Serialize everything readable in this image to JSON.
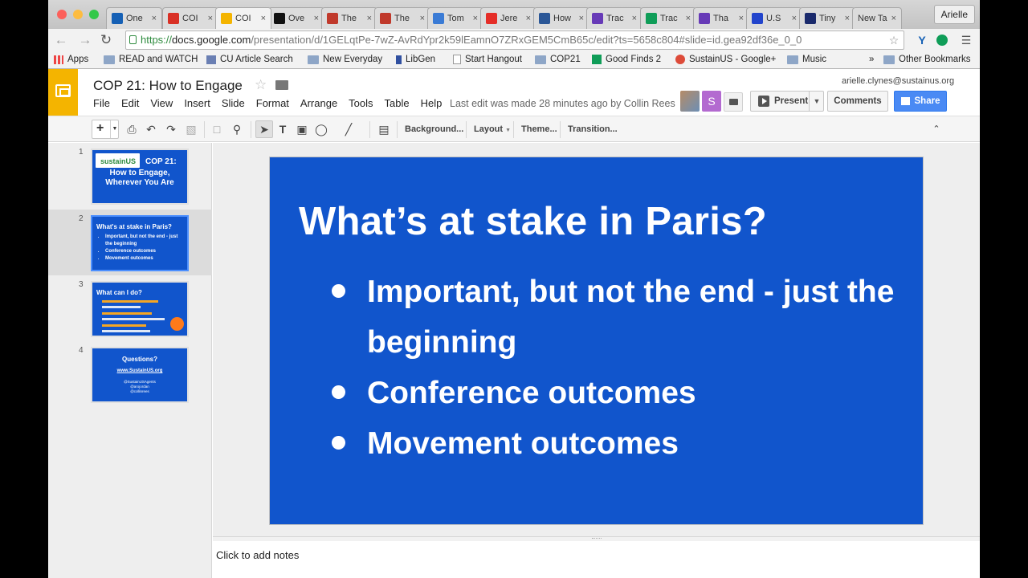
{
  "browser": {
    "tabs": [
      {
        "label": "One",
        "icon": "y-icon",
        "color": "#1560b5"
      },
      {
        "label": "COI",
        "icon": "gmail-icon",
        "color": "#d93025"
      },
      {
        "label": "COI",
        "icon": "slides-icon",
        "color": "#f4b400"
      },
      {
        "label": "Ove",
        "icon": "dash-icon",
        "color": "#111111"
      },
      {
        "label": "The",
        "icon": "n-icon",
        "color": "#c0392b"
      },
      {
        "label": "The",
        "icon": "br-icon",
        "color": "#c0392b"
      },
      {
        "label": "Tom",
        "icon": "td-icon",
        "color": "#3a7bd5"
      },
      {
        "label": "Jere",
        "icon": "youtube-icon",
        "color": "#e52d27"
      },
      {
        "label": "How",
        "icon": "hg-icon",
        "color": "#2b5797"
      },
      {
        "label": "Trac",
        "icon": "forms-icon",
        "color": "#673ab7"
      },
      {
        "label": "Trac",
        "icon": "sheets-icon",
        "color": "#0f9d58"
      },
      {
        "label": "Tha",
        "icon": "forms-icon",
        "color": "#673ab7"
      },
      {
        "label": "U.S",
        "icon": "b-icon",
        "color": "#2244cc"
      },
      {
        "label": "Tiny",
        "icon": "tinyurl-icon",
        "color": "#1a2a6c"
      },
      {
        "label": "New Ta",
        "icon": "",
        "color": ""
      }
    ],
    "user_label": "Arielle",
    "url": {
      "scheme": "https://",
      "host": "docs.google.com",
      "path": "/presentation/d/1GELqtPe-7wZ-AvRdYpr2k59lEamnO7ZRxGEM5CmB65c/edit?ts=5658c804#slide=id.gea92df36e_0_0"
    },
    "bookmarks": [
      {
        "label": "Apps",
        "icon": "apps-grid-icon"
      },
      {
        "label": "READ and WATCH",
        "icon": "folder-icon"
      },
      {
        "label": "CU Article Search",
        "icon": "crown-icon"
      },
      {
        "label": "New Everyday",
        "icon": "folder-icon"
      },
      {
        "label": "LibGen",
        "icon": "libgen-icon"
      },
      {
        "label": "Start Hangout",
        "icon": "page-icon"
      },
      {
        "label": "COP21",
        "icon": "folder-icon"
      },
      {
        "label": "Good Finds 2",
        "icon": "sheets-icon"
      },
      {
        "label": "SustainUS - Google+",
        "icon": "gplus-icon"
      },
      {
        "label": "Music",
        "icon": "folder-icon"
      }
    ],
    "bookmarks_overflow": "»",
    "other_bookmarks": "Other Bookmarks"
  },
  "app": {
    "title": "COP 21: How to Engage",
    "menu": [
      "File",
      "Edit",
      "View",
      "Insert",
      "Slide",
      "Format",
      "Arrange",
      "Tools",
      "Table",
      "Help"
    ],
    "last_edit": "Last edit was made 28 minutes ago by Collin Rees",
    "account_email": "arielle.clynes@sustainus.org",
    "collaborator_initial": "S",
    "present_label": "Present",
    "comments_label": "Comments",
    "share_label": "Share"
  },
  "toolbar": {
    "background_label": "Background...",
    "layout_label": "Layout",
    "theme_label": "Theme...",
    "transition_label": "Transition..."
  },
  "filmstrip": [
    {
      "number": "1",
      "logo_text": "sustainUS",
      "title_top": "COP 21:",
      "title_rest": "How to Engage, Wherever You Are"
    },
    {
      "number": "2",
      "title": "What's at stake in Paris?",
      "bullets": [
        "Important, but not the end - just the beginning",
        "Conference outcomes",
        "Movement outcomes"
      ]
    },
    {
      "number": "3",
      "title": "What can I do?"
    },
    {
      "number": "4",
      "title": "Questions?",
      "url": "www.SustainUS.org",
      "handles": [
        "@SustainUSAgents",
        "@arojordan",
        "@collinrees"
      ]
    }
  ],
  "slide": {
    "title": "What’s at stake in Paris?",
    "bullets": [
      "Important, but not the end - just the beginning",
      "Conference outcomes",
      "Movement outcomes"
    ],
    "background_color": "#1155cc"
  },
  "notes": {
    "placeholder": "Click to add notes"
  }
}
